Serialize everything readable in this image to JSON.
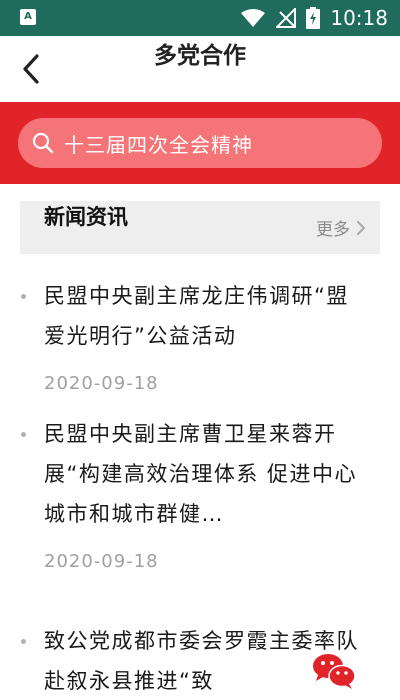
{
  "statusbar": {
    "time": "10:18",
    "app_icon_text": "A"
  },
  "nav": {
    "title": "多党合作"
  },
  "search": {
    "text": "十三届四次全会精神"
  },
  "section": {
    "title": "新闻资讯",
    "more_label": "更多"
  },
  "news": [
    {
      "title": "民盟中央副主席龙庄伟调研“盟爱光明行”公益活动",
      "date": "2020-09-18"
    },
    {
      "title": "民盟中央副主席曹卫星来蓉开展“构建高效治理体系 促进中心城市和城市群健…",
      "date": "2020-09-18"
    },
    {
      "title": "致公党成都市委会罗霞主委率队赴叙永县推进“致",
      "date": ""
    }
  ],
  "colors": {
    "statusbar": "#1f6b5c",
    "accent_red": "#e0242a",
    "search_box": "#f57478"
  },
  "icons": [
    "back-chevron-icon",
    "search-icon",
    "chevron-right-icon",
    "wifi-icon",
    "signal-icon",
    "battery-icon",
    "wechat-icon"
  ]
}
